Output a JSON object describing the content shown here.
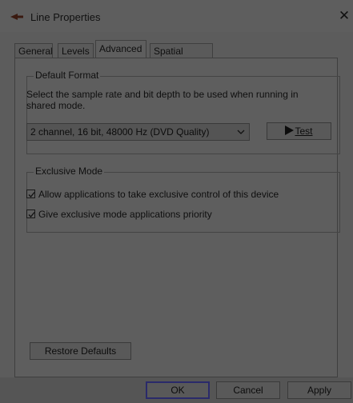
{
  "window": {
    "title": "Line Properties",
    "close_glyph": "✕",
    "icon": "speaker-arrow-icon"
  },
  "tabs": [
    {
      "label": "General"
    },
    {
      "label": "Levels"
    },
    {
      "label": "Advanced",
      "active": true
    },
    {
      "label": "Spatial sound"
    }
  ],
  "default_format": {
    "title": "Default Format",
    "description": "Select the sample rate and bit depth to be used when running in shared mode.",
    "selected": "2 channel, 16 bit, 48000 Hz (DVD Quality)",
    "test_label": "Test"
  },
  "exclusive_mode": {
    "title": "Exclusive Mode",
    "options": [
      {
        "label": "Allow applications to take exclusive control of this device",
        "checked": true
      },
      {
        "label": "Give exclusive mode applications priority",
        "checked": true
      }
    ]
  },
  "restore_label": "Restore Defaults",
  "buttons": {
    "ok": "OK",
    "cancel": "Cancel",
    "apply": "Apply"
  },
  "colors": {
    "overlay_bg": "#5e5e5e",
    "ok_border": "#2a2a6a"
  }
}
